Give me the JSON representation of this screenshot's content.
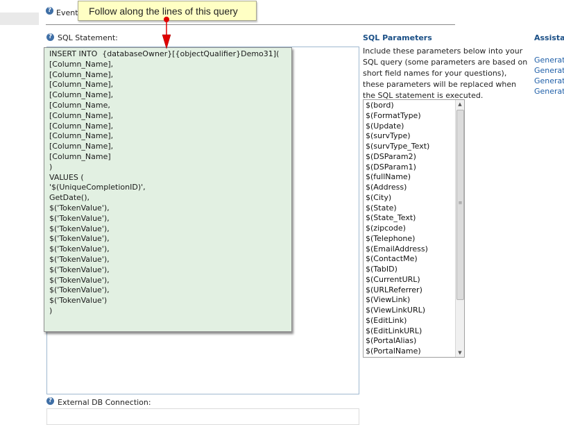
{
  "top": {
    "events_label": "Event"
  },
  "tooltip": {
    "text": "Follow along the lines of this query"
  },
  "sql": {
    "label": "SQL Statement:",
    "lines": [
      "INSERT INTO  {databaseOwner}[{objectQualifier}Demo31](",
      "[Column_Name],",
      "[Column_Name],",
      "[Column_Name],",
      "[Column_Name],",
      "[Column_Name,",
      "[Column_Name],",
      "[Column_Name],",
      "[Column_Name],",
      "[Column_Name],",
      "[Column_Name]",
      ")",
      "VALUES (",
      "'$(UniqueCompletionID)',",
      "GetDate(),",
      "$('TokenValue'),",
      "$('TokenValue'),",
      "$('TokenValue'),",
      "$('TokenValue'),",
      "$('TokenValue'),",
      "$('TokenValue'),",
      "$('TokenValue'),",
      "$('TokenValue'),",
      "$('TokenValue'),",
      "$('TokenValue')",
      ")"
    ]
  },
  "params": {
    "heading": "SQL Parameters",
    "description": "Include these parameters below into your SQL query (some parameters are based on short field names for your questions), these parameters will be replaced when the SQL statement is executed.",
    "items": [
      "$(bord)",
      "$(FormatType)",
      "$(Update)",
      "$(survType)",
      "$(survType_Text)",
      "$(DSParam2)",
      "$(DSParam1)",
      "$(fullName)",
      "$(Address)",
      "$(City)",
      "$(State)",
      "$(State_Text)",
      "$(zipcode)",
      "$(Telephone)",
      "$(EmailAddress)",
      "$(ContactMe)",
      "$(TabID)",
      "$(CurrentURL)",
      "$(URLReferrer)",
      "$(ViewLink)",
      "$(ViewLinkURL)",
      "$(EditLink)",
      "$(EditLinkURL)",
      "$(PortalAlias)",
      "$(PortalName)"
    ]
  },
  "assistant": {
    "heading": "Assistan",
    "links": [
      "Generat",
      "Generat",
      "Generat",
      "Generat"
    ]
  },
  "external": {
    "label": "External DB Connection:"
  },
  "colors": {
    "accent": "#1a4f86",
    "sql_bg": "#e2f0e2",
    "tooltip_bg": "#ffffc4",
    "arrow": "#e00000"
  }
}
